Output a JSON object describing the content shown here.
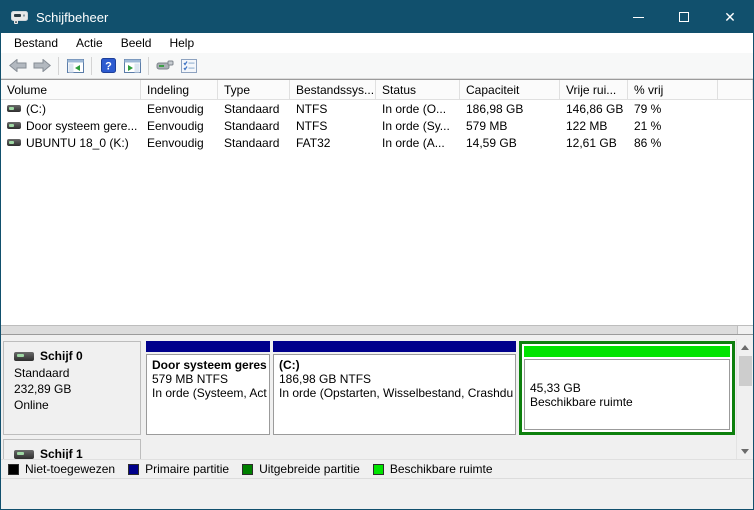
{
  "window": {
    "title": "Schijfbeheer"
  },
  "menu": {
    "items": [
      "Bestand",
      "Actie",
      "Beeld",
      "Help"
    ]
  },
  "toolbar": {
    "icons": [
      "back",
      "forward",
      "show-console-tree",
      "help",
      "show-action-pane",
      "rescan-disks",
      "properties"
    ]
  },
  "volume_table": {
    "columns": [
      "Volume",
      "Indeling",
      "Type",
      "Bestandssys...",
      "Status",
      "Capaciteit",
      "Vrije rui...",
      "% vrij"
    ],
    "rows": [
      {
        "cells": [
          "(C:)",
          "Eenvoudig",
          "Standaard",
          "NTFS",
          "In orde (O...",
          "186,98 GB",
          "146,86 GB",
          "79 %"
        ]
      },
      {
        "cells": [
          "Door systeem gere...",
          "Eenvoudig",
          "Standaard",
          "NTFS",
          "In orde (Sy...",
          "579 MB",
          "122 MB",
          "21 %"
        ]
      },
      {
        "cells": [
          "UBUNTU 18_0 (K:)",
          "Eenvoudig",
          "Standaard",
          "FAT32",
          "In orde (A...",
          "14,59 GB",
          "12,61 GB",
          "86 %"
        ]
      }
    ]
  },
  "disks": [
    {
      "name": "Schijf 0",
      "type": "Standaard",
      "size": "232,89 GB",
      "status": "Online",
      "partitions": [
        {
          "title": "Door systeem geres",
          "size_line": "579 MB NTFS",
          "status_line": "In orde (Systeem, Act",
          "kind": "primary"
        },
        {
          "title": "(C:)",
          "size_line": "186,98 GB NTFS",
          "status_line": "In orde (Opstarten, Wisselbestand, Crashdu",
          "kind": "primary"
        },
        {
          "size_line": "45,33 GB",
          "label": "Beschikbare ruimte",
          "kind": "free"
        }
      ]
    },
    {
      "name": "Schijf 1"
    }
  ],
  "legend": {
    "items": [
      {
        "label": "Niet-toegewezen",
        "color": "#000000"
      },
      {
        "label": "Primaire partitie",
        "color": "#00008b"
      },
      {
        "label": "Uitgebreide partitie",
        "color": "#008000"
      },
      {
        "label": "Beschikbare ruimte",
        "color": "#00e400"
      }
    ]
  },
  "colors": {
    "titlebar": "#11506d",
    "primary_partition": "#00008b",
    "extended_partition_border": "#008000",
    "free_space": "#00e400"
  }
}
